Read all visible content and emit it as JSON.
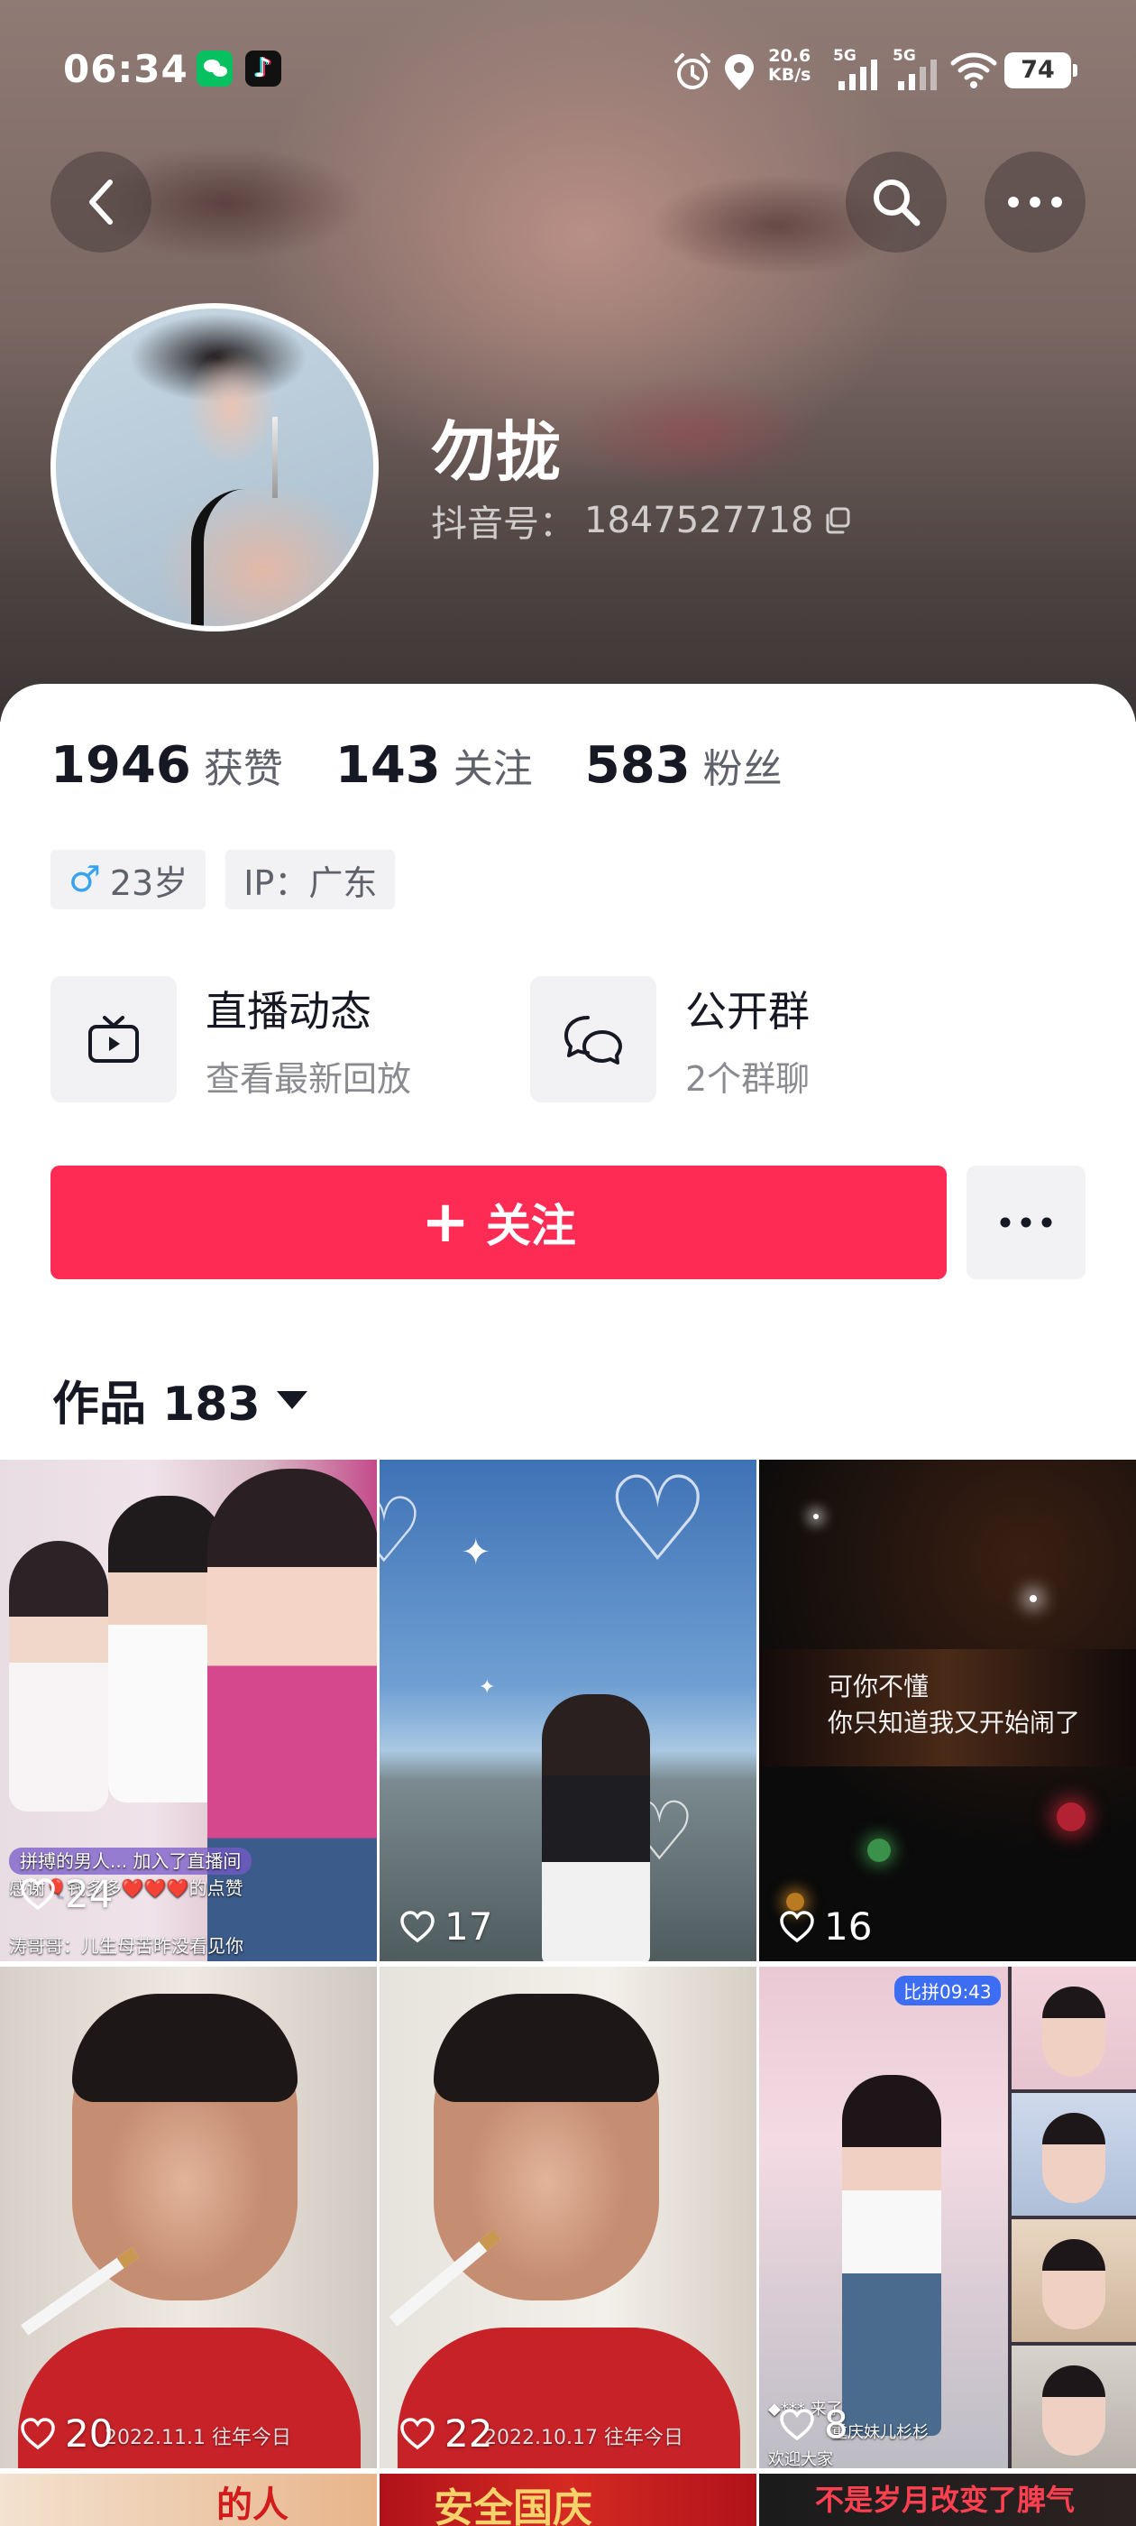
{
  "status_bar": {
    "time": "06:34",
    "network_speed_value": "20.6",
    "network_speed_unit": "KB/s",
    "signal_1_label": "5G",
    "signal_2_label": "5G",
    "battery": "74",
    "notification_icons": [
      "wechat-icon",
      "tiktok-icon"
    ],
    "system_icons": [
      "alarm-icon",
      "location-icon",
      "signal-icon",
      "signal-icon",
      "wifi-icon",
      "battery-icon"
    ]
  },
  "profile": {
    "nickname": "勿拢",
    "douyin_id_label": "抖音号：",
    "douyin_id": "1847527718"
  },
  "stats": [
    {
      "value": "1946",
      "label": "获赞"
    },
    {
      "value": "143",
      "label": "关注"
    },
    {
      "value": "583",
      "label": "粉丝"
    }
  ],
  "tags": {
    "gender_symbol": "♂",
    "age": "23岁",
    "ip": "IP：广东"
  },
  "entries": {
    "live": {
      "title": "直播动态",
      "subtitle": "查看最新回放"
    },
    "group": {
      "title": "公开群",
      "subtitle": "2个群聊"
    }
  },
  "actions": {
    "follow_icon": "+",
    "follow_label": "关注"
  },
  "works_tab": {
    "label": "作品",
    "count": "183"
  },
  "videos": [
    {
      "likes": "24",
      "overlay_lines": [
        "拼搏的男人... 加入了直播间",
        "感谢🎈钱多多❤️❤️❤️的点赞",
        "涛哥哥：儿生母苦昨没看见你"
      ]
    },
    {
      "likes": "17"
    },
    {
      "likes": "16",
      "lyrics": [
        "可你不懂",
        "你只知道我又开始闹了"
      ]
    },
    {
      "likes": "20",
      "date": "2022.11.1 往年今日"
    },
    {
      "likes": "22",
      "date": "2022.10.17 往年今日"
    },
    {
      "likes": "8",
      "pk_timer": "比拼09:43",
      "chat_lines": [
        "◆*** 来了",
        "重庆妹儿杉杉",
        "欢迎大家"
      ]
    }
  ],
  "third_row": [
    {
      "text": "的人"
    },
    {
      "text": "安全国庆"
    },
    {
      "text": "不是岁月改变了脾气"
    }
  ],
  "colors": {
    "primary_red": "#fe2c55",
    "gender_blue": "#3aa3f0",
    "text_primary": "#161823",
    "text_secondary": "#5f616b"
  }
}
